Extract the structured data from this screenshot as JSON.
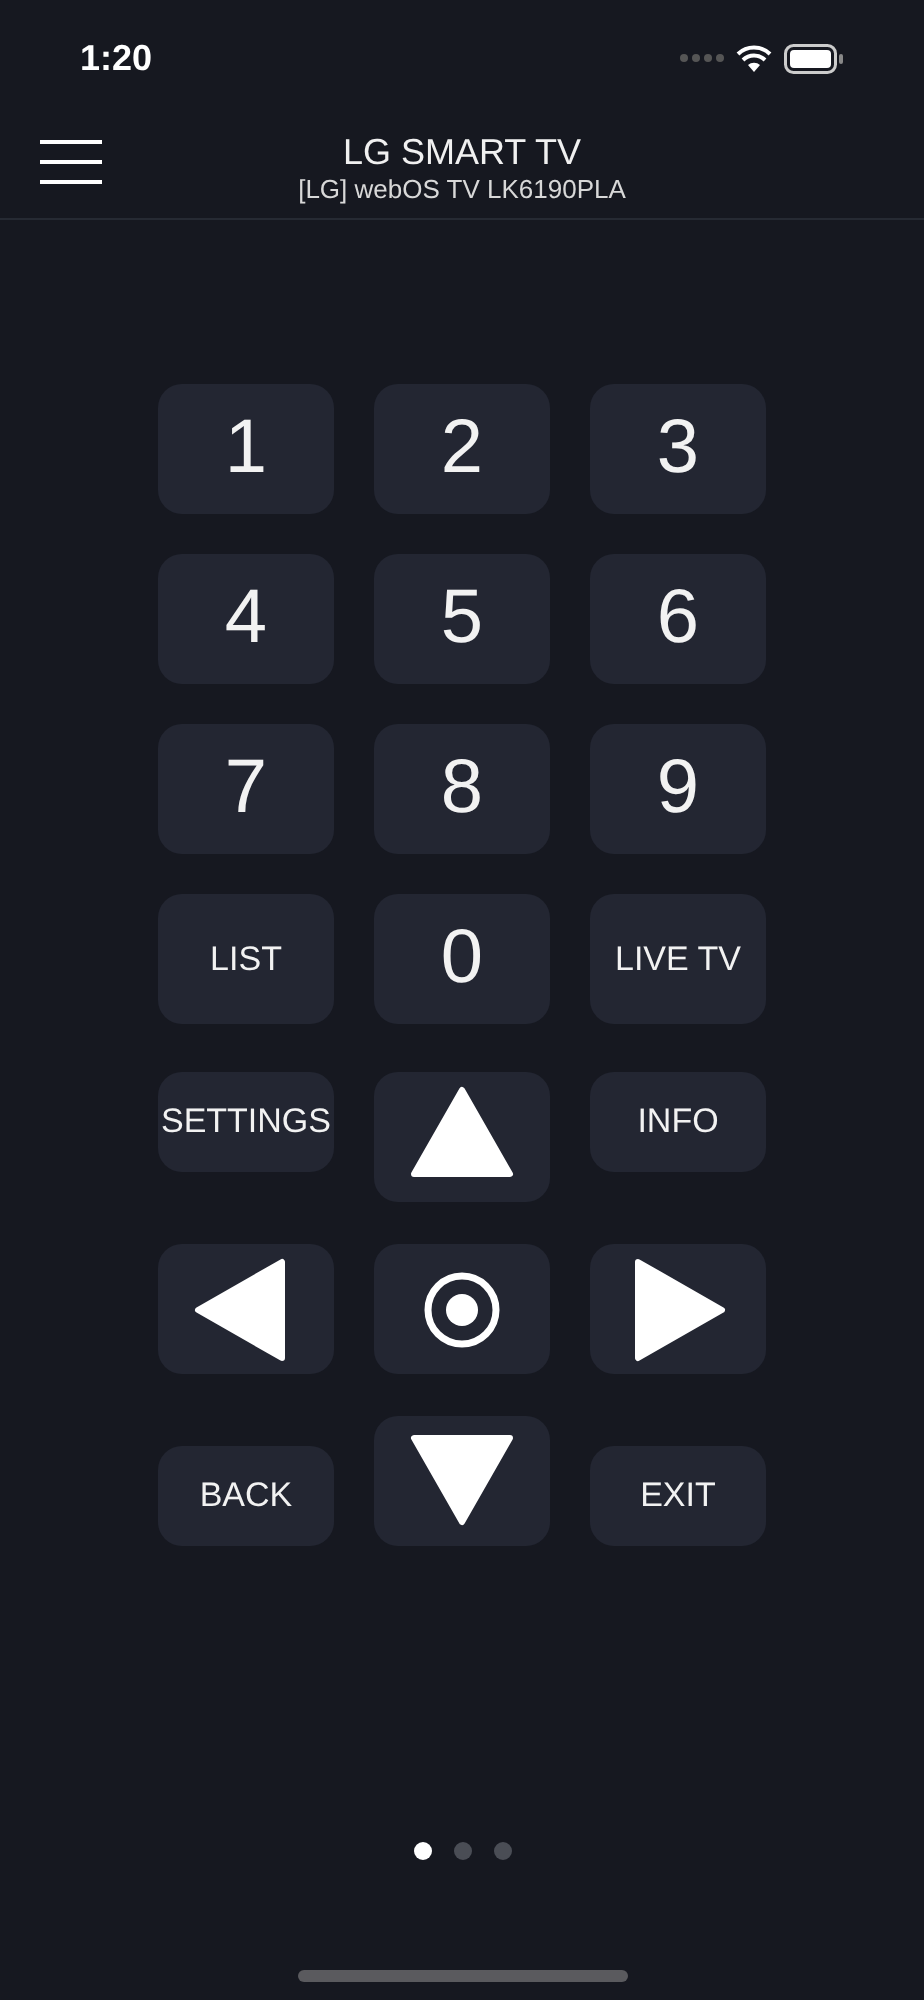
{
  "status_bar": {
    "time": "1:20"
  },
  "header": {
    "title": "LG SMART TV",
    "subtitle": "[LG] webOS TV LK6190PLA"
  },
  "keypad": [
    [
      {
        "kind": "digit",
        "label": "1"
      },
      {
        "kind": "digit",
        "label": "2"
      },
      {
        "kind": "digit",
        "label": "3"
      }
    ],
    [
      {
        "kind": "digit",
        "label": "4"
      },
      {
        "kind": "digit",
        "label": "5"
      },
      {
        "kind": "digit",
        "label": "6"
      }
    ],
    [
      {
        "kind": "digit",
        "label": "7"
      },
      {
        "kind": "digit",
        "label": "8"
      },
      {
        "kind": "digit",
        "label": "9"
      }
    ],
    [
      {
        "kind": "label",
        "label": "LIST"
      },
      {
        "kind": "digit",
        "label": "0"
      },
      {
        "kind": "label",
        "label": "LIVE TV"
      }
    ]
  ],
  "navigation": [
    [
      {
        "kind": "label",
        "label": "SETTINGS"
      },
      {
        "kind": "up"
      },
      {
        "kind": "label",
        "label": "INFO"
      }
    ],
    [
      {
        "kind": "left"
      },
      {
        "kind": "ok"
      },
      {
        "kind": "right"
      }
    ],
    [
      {
        "kind": "label",
        "label": "BACK"
      },
      {
        "kind": "down"
      },
      {
        "kind": "label",
        "label": "EXIT"
      }
    ]
  ],
  "pages": [
    {
      "selected": true
    },
    {
      "selected": false
    },
    {
      "selected": false
    }
  ]
}
